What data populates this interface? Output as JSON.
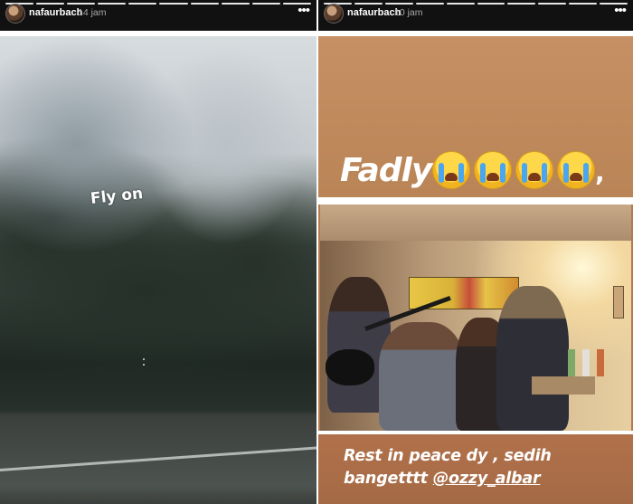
{
  "stories": [
    {
      "username": "nafaurbach",
      "time": "14 jam",
      "more": "•••",
      "caption": "Fly on"
    },
    {
      "username": "nafaurbach",
      "time": "10 jam",
      "more": "•••",
      "caption_top": "Fadly",
      "caption_top_suffix": ",",
      "emoji": [
        "crying-face",
        "crying-face",
        "crying-face",
        "crying-face"
      ],
      "caption_bottom_line1": "Rest in peace dy , sedih",
      "caption_bottom_line2_prefix": "bangetttt ",
      "caption_bottom_mention": "@ozzy_albar"
    }
  ],
  "colors": {
    "header_bg": "#111111",
    "right_story_bg": "#b57951",
    "progress": "#ffffff"
  }
}
